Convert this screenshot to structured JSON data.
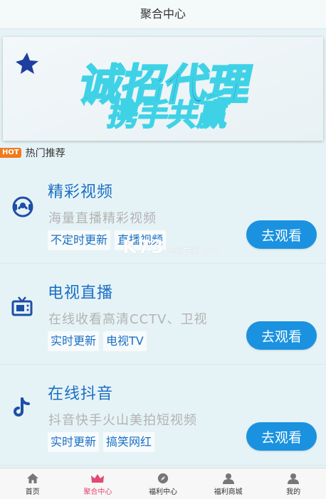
{
  "header": {
    "title": "聚合中心"
  },
  "banner": {
    "line1": "诚招代理",
    "line2": "携手共赢"
  },
  "section": {
    "badge": "HOT",
    "label": "热门推荐"
  },
  "cards": [
    {
      "title": "精彩视频",
      "desc": "海量直播精彩视频",
      "tags": [
        "不定时更新",
        "直播视频"
      ],
      "button": "去观看",
      "icon": "video-headset-icon"
    },
    {
      "title": "电视直播",
      "desc": "在线收看高清CCTV、卫视",
      "tags": [
        "实时更新",
        "电视TV"
      ],
      "button": "去观看",
      "icon": "tv-icon"
    },
    {
      "title": "在线抖音",
      "desc": "抖音快手火山美拍短视频",
      "tags": [
        "实时更新",
        "搞笑网红"
      ],
      "button": "去观看",
      "icon": "tiktok-icon"
    }
  ],
  "watermark": {
    "brand": "K73",
    "sub": "电玩之家",
    "url": ".com"
  },
  "nav": [
    {
      "label": "首页",
      "icon": "home-icon"
    },
    {
      "label": "聚合中心",
      "icon": "crown-icon",
      "active": true
    },
    {
      "label": "福利中心",
      "icon": "compass-icon"
    },
    {
      "label": "福利商城",
      "icon": "user-icon"
    },
    {
      "label": "我的",
      "icon": "user-icon"
    }
  ],
  "colors": {
    "accent": "#1a92e0",
    "title_blue": "#1a6fc4",
    "active_nav": "#e24a72",
    "hot": "#f07a1c"
  }
}
